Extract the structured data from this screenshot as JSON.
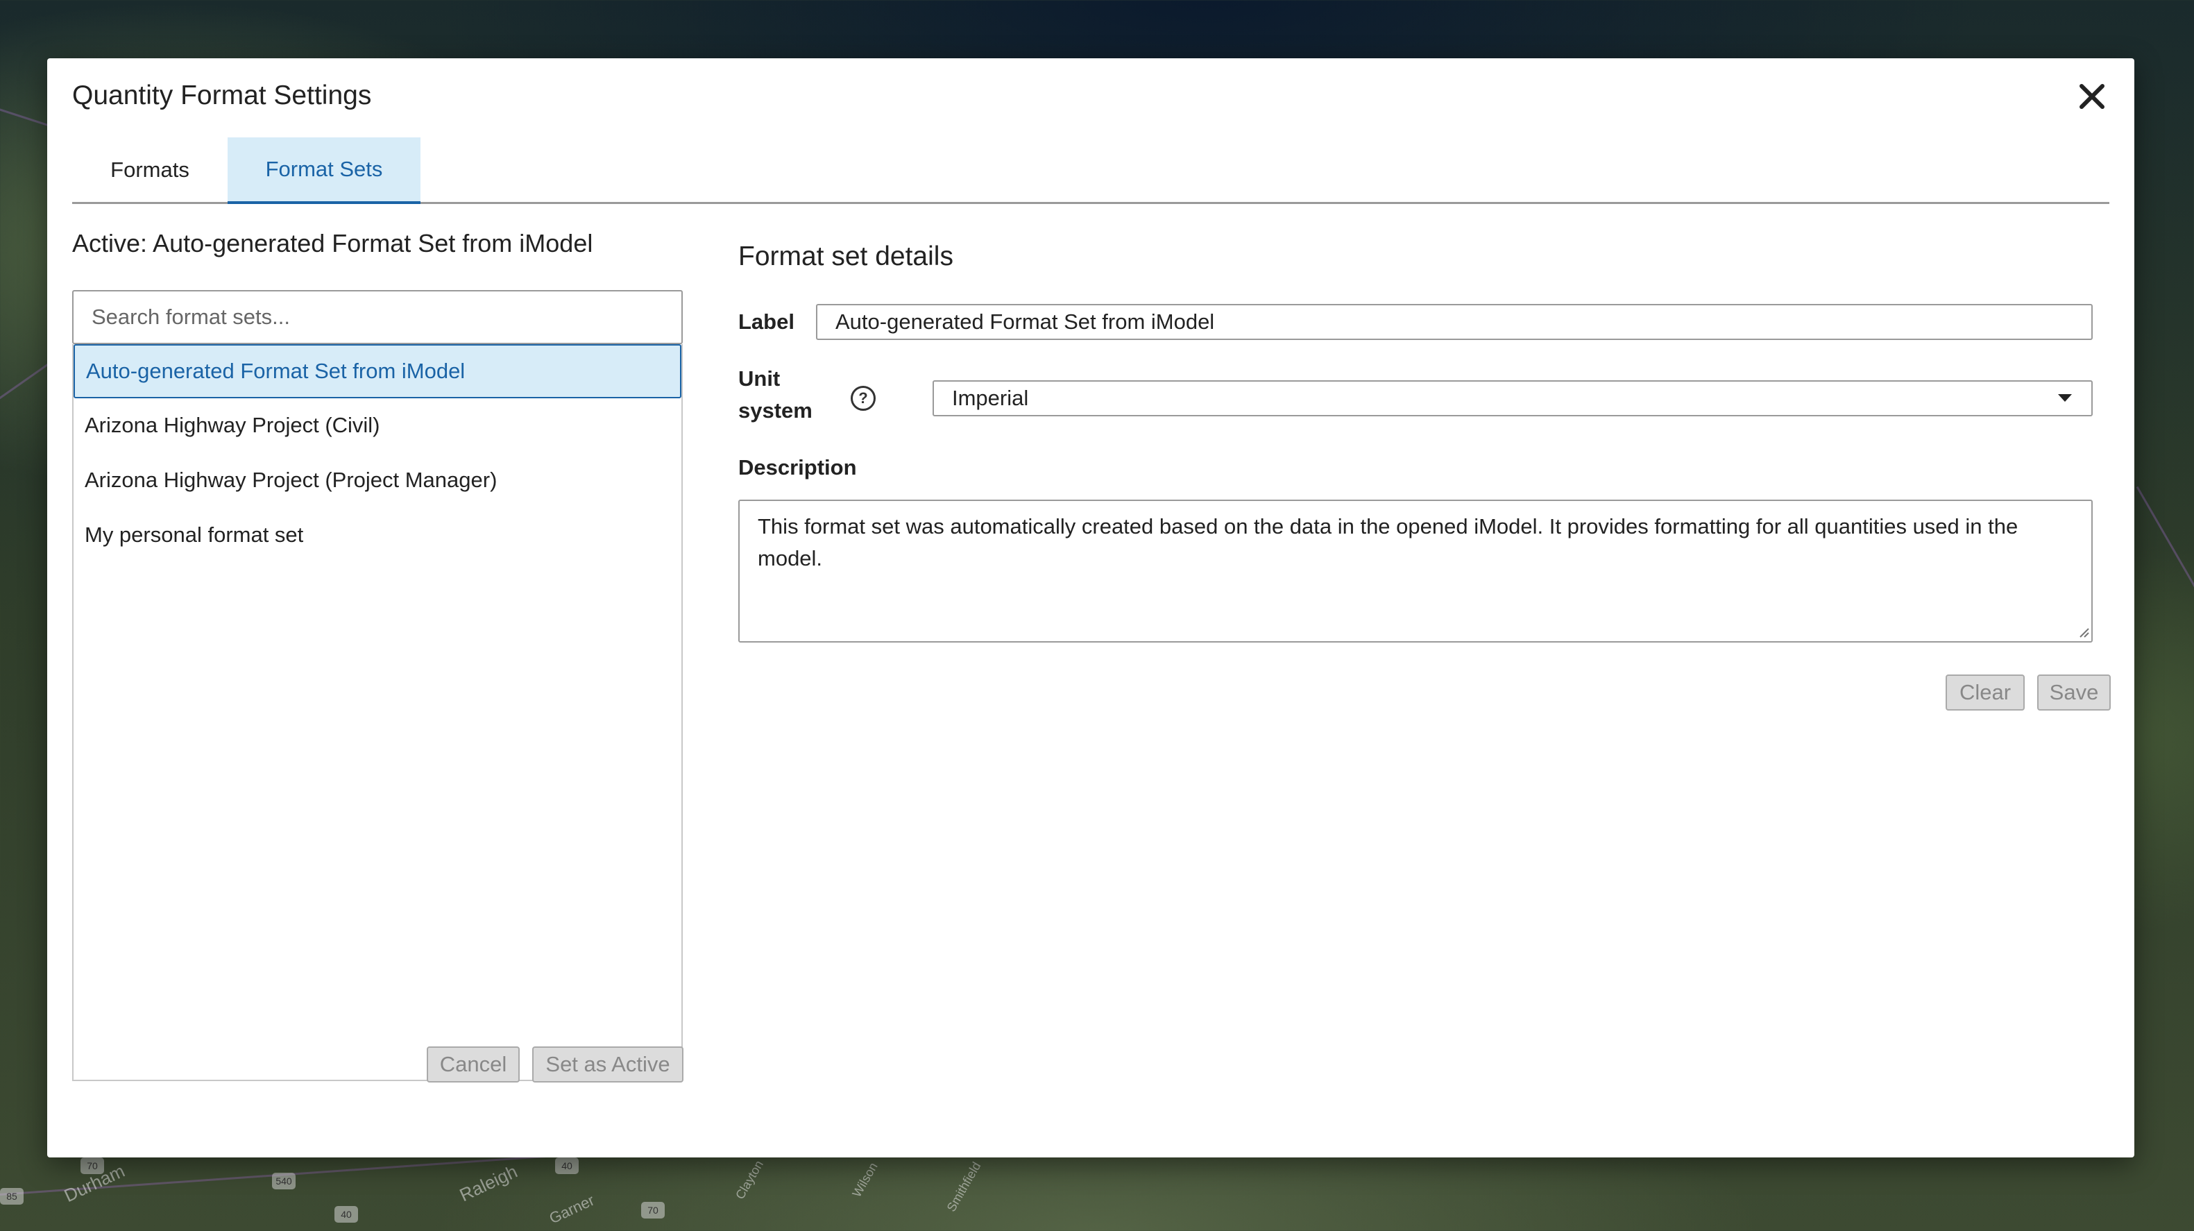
{
  "dialog": {
    "title": "Quantity Format Settings",
    "close_icon": "close-icon"
  },
  "tabs": [
    {
      "label": "Formats",
      "selected": false
    },
    {
      "label": "Format Sets",
      "selected": true
    }
  ],
  "left_panel": {
    "active_heading": "Active: Auto-generated Format Set from iModel",
    "search_placeholder": "Search format sets...",
    "search_value": "",
    "items": [
      {
        "label": "Auto-generated Format Set from iModel",
        "selected": true
      },
      {
        "label": "Arizona Highway Project (Civil)",
        "selected": false
      },
      {
        "label": "Arizona Highway Project (Project Manager)",
        "selected": false
      },
      {
        "label": "My personal format set",
        "selected": false
      }
    ],
    "cancel_label": "Cancel",
    "set_active_label": "Set as Active"
  },
  "details": {
    "title": "Format set details",
    "label_caption": "Label",
    "label_value": "Auto-generated Format Set from iModel",
    "unit_caption_line1": "Unit",
    "unit_caption_line2": "system",
    "help_icon_glyph": "?",
    "unit_value": "Imperial",
    "description_caption": "Description",
    "description_value": "This format set was automatically created based on the data in the opened iModel. It provides formatting for all quantities used in the model.",
    "clear_label": "Clear",
    "save_label": "Save"
  },
  "map": {
    "labels": [
      "Durham",
      "Raleigh",
      "Garner",
      "Smithfield",
      "Wilson",
      "Clayton"
    ],
    "shields": [
      "70",
      "540",
      "40",
      "70",
      "85",
      "40"
    ]
  },
  "colors": {
    "accent": "#1a63a6",
    "selected_bg": "#d7ecf8",
    "disabled_button_bg": "#dcdcdc"
  }
}
